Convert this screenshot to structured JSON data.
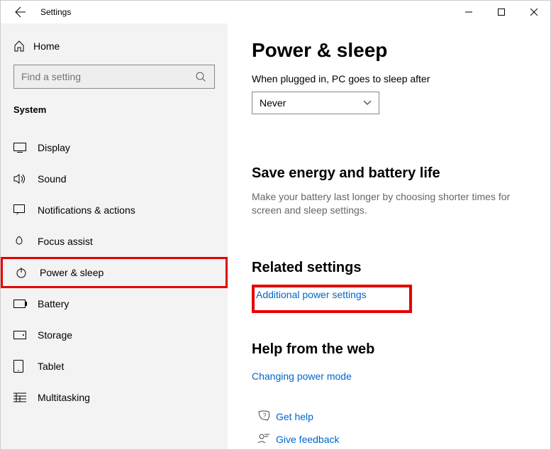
{
  "window": {
    "title": "Settings"
  },
  "sidebar": {
    "home": "Home",
    "search_placeholder": "Find a setting",
    "section": "System",
    "items": [
      {
        "label": "Display"
      },
      {
        "label": "Sound"
      },
      {
        "label": "Notifications & actions"
      },
      {
        "label": "Focus assist"
      },
      {
        "label": "Power & sleep"
      },
      {
        "label": "Battery"
      },
      {
        "label": "Storage"
      },
      {
        "label": "Tablet"
      },
      {
        "label": "Multitasking"
      }
    ]
  },
  "main": {
    "title": "Power & sleep",
    "plugged_label": "When plugged in, PC goes to sleep after",
    "sleep_value": "Never",
    "energy_heading": "Save energy and battery life",
    "energy_body": "Make your battery last longer by choosing shorter times for screen and sleep settings.",
    "related_heading": "Related settings",
    "related_link": "Additional power settings",
    "help_heading": "Help from the web",
    "help_link": "Changing power mode",
    "get_help": "Get help",
    "give_feedback": "Give feedback"
  }
}
